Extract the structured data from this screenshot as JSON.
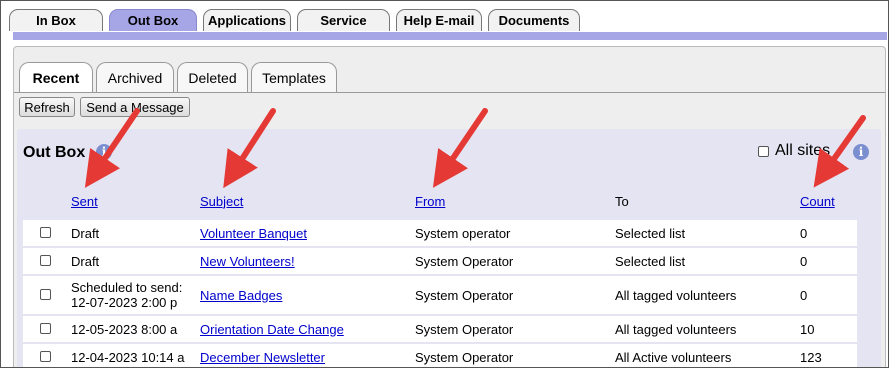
{
  "top_tabs": [
    "In Box",
    "Out Box",
    "Applications",
    "Service",
    "Help E-mail",
    "Documents"
  ],
  "active_top_tab": "Out Box",
  "sub_tabs": [
    "Recent",
    "Archived",
    "Deleted",
    "Templates"
  ],
  "active_sub_tab": "Recent",
  "buttons": {
    "refresh": "Refresh",
    "send_message": "Send a Message"
  },
  "outbox": {
    "title": "Out Box",
    "info_icon": "info-icon",
    "all_sites_label": "All sites",
    "columns": {
      "sent": "Sent",
      "subject": "Subject",
      "from": "From",
      "to": "To",
      "count": "Count"
    },
    "rows": [
      {
        "sent": "Draft",
        "subject": "Volunteer Banquet",
        "from": "System operator",
        "to": "Selected list",
        "count": "0"
      },
      {
        "sent": "Draft",
        "subject": "New Volunteers!",
        "from": "System Operator",
        "to": "Selected list",
        "count": "0"
      },
      {
        "sent_line1": "Scheduled to send:",
        "sent_line2": "12-07-2023 2:00 p",
        "subject": "Name Badges",
        "from": "System Operator",
        "to": "All tagged volunteers",
        "count": "0"
      },
      {
        "sent": "12-05-2023 8:00 a",
        "subject": "Orientation Date Change",
        "from": "System Operator",
        "to": "All tagged volunteers",
        "count": "10"
      },
      {
        "sent": "12-04-2023 10:14 a",
        "subject": "December Newsletter",
        "from": "System Operator",
        "to": "All Active volunteers",
        "count": "123"
      }
    ]
  },
  "colors": {
    "tab_active": "#a6a6e6",
    "outbox_bg": "#e4e4f2",
    "link": "#0000cc",
    "arrow": "#e53935",
    "info": "#7b8fd0"
  }
}
